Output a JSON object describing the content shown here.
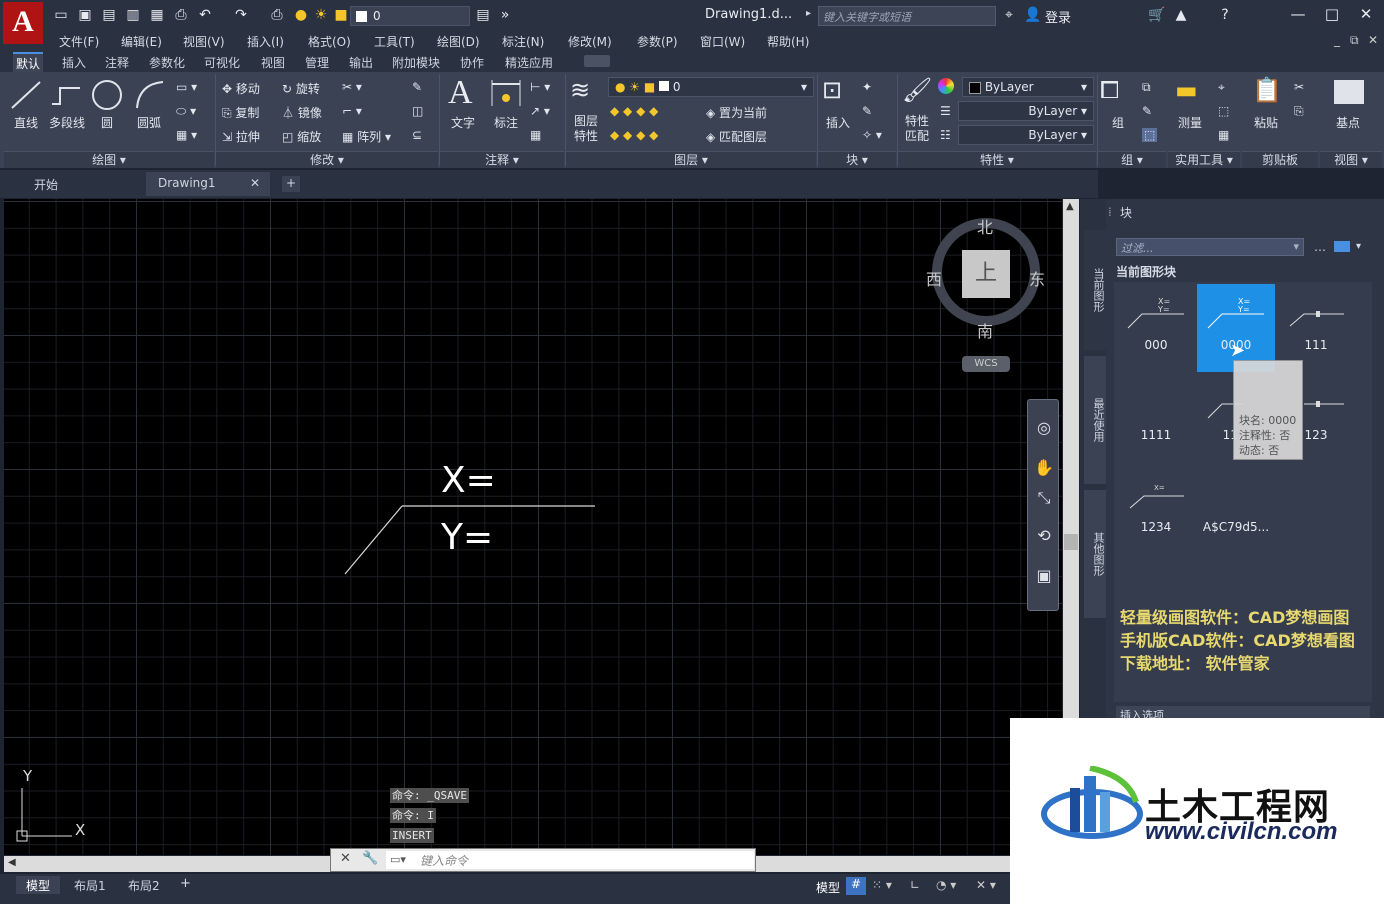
{
  "app": {
    "logo_letter": "A",
    "document_title": "Drawing1.d...",
    "search_placeholder": "键入关键字或短语",
    "login": "登录",
    "quick_layer": "0"
  },
  "menu": [
    "文件(F)",
    "编辑(E)",
    "视图(V)",
    "插入(I)",
    "格式(O)",
    "工具(T)",
    "绘图(D)",
    "标注(N)",
    "修改(M)",
    "参数(P)",
    "窗口(W)",
    "帮助(H)"
  ],
  "ribbon_tabs": [
    "默认",
    "插入",
    "注释",
    "参数化",
    "可视化",
    "视图",
    "管理",
    "输出",
    "附加模块",
    "协作",
    "精选应用"
  ],
  "ribbon": {
    "draw": {
      "line": "直线",
      "polyline": "多段线",
      "circle": "圆",
      "arc": "圆弧",
      "panel": "绘图"
    },
    "modify": {
      "move": "移动",
      "rotate": "旋转",
      "copy": "复制",
      "mirror": "镜像",
      "stretch": "拉伸",
      "scale": "缩放",
      "array": "阵列",
      "panel": "修改"
    },
    "annotation": {
      "text": "文字",
      "dimension": "标注",
      "panel": "注释"
    },
    "layers": {
      "props": "图层\n特性",
      "layer_value": "0",
      "set_current": "置为当前",
      "match_layer": "匹配图层",
      "panel": "图层"
    },
    "block": {
      "insert": "插入",
      "panel": "块"
    },
    "properties": {
      "match": "特性\n匹配",
      "color": "ByLayer",
      "linetype": "ByLayer",
      "lineweight": "ByLayer",
      "panel": "特性"
    },
    "groups": {
      "group": "组",
      "panel": "组"
    },
    "utilities": {
      "measure": "测量",
      "panel": "实用工具"
    },
    "clipboard": {
      "paste": "粘贴",
      "panel": "剪贴板"
    },
    "view": {
      "base": "基点",
      "panel": "视图"
    }
  },
  "doc_tabs": [
    "开始",
    "Drawing1"
  ],
  "viewcube": {
    "north": "北",
    "south": "南",
    "east": "东",
    "west": "西",
    "face": "上",
    "wcs": "WCS"
  },
  "drawing": {
    "x_label": "X=",
    "y_label": "Y="
  },
  "ucs": {
    "x": "X",
    "y": "Y"
  },
  "command_history": [
    "命令: _QSAVE",
    "命令: I",
    "INSERT"
  ],
  "command_placeholder": "键入命令",
  "layout_tabs": [
    "模型",
    "布局1",
    "布局2"
  ],
  "status": {
    "model": "模型"
  },
  "palette": {
    "title": "块",
    "filter": "过滤...",
    "section": "当前图形块",
    "side_tabs": [
      "当前图形",
      "最近使用",
      "其他图形"
    ],
    "blocks": [
      "000",
      "0000",
      "111",
      "1111",
      "11...",
      "123",
      "1234",
      "A$C79d5..."
    ],
    "tooltip": {
      "name": "块名: 0000",
      "annotative": "注释性: 否",
      "dynamic": "动态: 否"
    },
    "insert_options": "插入选项",
    "promo": [
      "轻量级画图软件：CAD梦想画图",
      "手机版CAD软件：CAD梦想看图",
      "下载地址： 软件管家"
    ]
  },
  "watermark": {
    "brand": "土木工程网",
    "url": "www.civilcn.com"
  }
}
